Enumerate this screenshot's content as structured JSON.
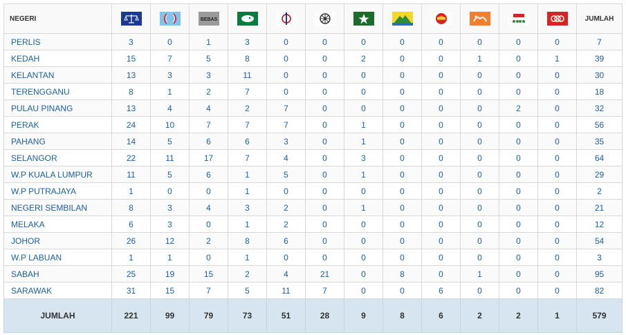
{
  "header": {
    "negeri_label": "NEGERI",
    "jumlah_label": "JUMLAH",
    "bebas_label": "BEBAS",
    "parties": [
      {
        "icon": "bn-scales-icon",
        "color": "#1a3a8f"
      },
      {
        "icon": "pkr-eye-icon",
        "color": "#7fc4ec"
      },
      {
        "icon": "bebas-independent-icon",
        "color": "#9a9a9a"
      },
      {
        "icon": "pas-moon-icon",
        "color": "#0b7a3e"
      },
      {
        "icon": "dap-rocket-icon",
        "color": "#cc0000"
      },
      {
        "icon": "wheel-icon",
        "color": "#333333"
      },
      {
        "icon": "star-icon",
        "color": "#1d6b2a"
      },
      {
        "icon": "mountain-icon",
        "color": "#2a6fb6"
      },
      {
        "icon": "sunrise-icon",
        "color": "#e8a317"
      },
      {
        "icon": "hands-icon",
        "color": "#f08030"
      },
      {
        "icon": "stars-emblem-icon",
        "color": "#d42424"
      },
      {
        "icon": "rings-icon",
        "color": "#d42424"
      }
    ]
  },
  "rows": [
    {
      "state": "PERLIS",
      "values": [
        "3",
        "0",
        "1",
        "3",
        "0",
        "0",
        "0",
        "0",
        "0",
        "0",
        "0",
        "0"
      ],
      "total": "7"
    },
    {
      "state": "KEDAH",
      "values": [
        "15",
        "7",
        "5",
        "8",
        "0",
        "0",
        "2",
        "0",
        "0",
        "1",
        "0",
        "1"
      ],
      "total": "39"
    },
    {
      "state": "KELANTAN",
      "values": [
        "13",
        "3",
        "3",
        "11",
        "0",
        "0",
        "0",
        "0",
        "0",
        "0",
        "0",
        "0"
      ],
      "total": "30"
    },
    {
      "state": "TERENGGANU",
      "values": [
        "8",
        "1",
        "2",
        "7",
        "0",
        "0",
        "0",
        "0",
        "0",
        "0",
        "0",
        "0"
      ],
      "total": "18"
    },
    {
      "state": "PULAU PINANG",
      "values": [
        "13",
        "4",
        "4",
        "2",
        "7",
        "0",
        "0",
        "0",
        "0",
        "0",
        "2",
        "0"
      ],
      "total": "32"
    },
    {
      "state": "PERAK",
      "values": [
        "24",
        "10",
        "7",
        "7",
        "7",
        "0",
        "1",
        "0",
        "0",
        "0",
        "0",
        "0"
      ],
      "total": "56"
    },
    {
      "state": "PAHANG",
      "values": [
        "14",
        "5",
        "6",
        "6",
        "3",
        "0",
        "1",
        "0",
        "0",
        "0",
        "0",
        "0"
      ],
      "total": "35"
    },
    {
      "state": "SELANGOR",
      "values": [
        "22",
        "11",
        "17",
        "7",
        "4",
        "0",
        "3",
        "0",
        "0",
        "0",
        "0",
        "0"
      ],
      "total": "64"
    },
    {
      "state": "W.P KUALA LUMPUR",
      "values": [
        "11",
        "5",
        "6",
        "1",
        "5",
        "0",
        "1",
        "0",
        "0",
        "0",
        "0",
        "0"
      ],
      "total": "29"
    },
    {
      "state": "W.P PUTRAJAYA",
      "values": [
        "1",
        "0",
        "0",
        "1",
        "0",
        "0",
        "0",
        "0",
        "0",
        "0",
        "0",
        "0"
      ],
      "total": "2"
    },
    {
      "state": "NEGERI SEMBILAN",
      "values": [
        "8",
        "3",
        "4",
        "3",
        "2",
        "0",
        "1",
        "0",
        "0",
        "0",
        "0",
        "0"
      ],
      "total": "21"
    },
    {
      "state": "MELAKA",
      "values": [
        "6",
        "3",
        "0",
        "1",
        "2",
        "0",
        "0",
        "0",
        "0",
        "0",
        "0",
        "0"
      ],
      "total": "12"
    },
    {
      "state": "JOHOR",
      "values": [
        "26",
        "12",
        "2",
        "8",
        "6",
        "0",
        "0",
        "0",
        "0",
        "0",
        "0",
        "0"
      ],
      "total": "54"
    },
    {
      "state": "W.P LABUAN",
      "values": [
        "1",
        "1",
        "0",
        "1",
        "0",
        "0",
        "0",
        "0",
        "0",
        "0",
        "0",
        "0"
      ],
      "total": "3"
    },
    {
      "state": "SABAH",
      "values": [
        "25",
        "19",
        "15",
        "2",
        "4",
        "21",
        "0",
        "8",
        "0",
        "1",
        "0",
        "0"
      ],
      "total": "95"
    },
    {
      "state": "SARAWAK",
      "values": [
        "31",
        "15",
        "7",
        "5",
        "11",
        "7",
        "0",
        "0",
        "6",
        "0",
        "0",
        "0"
      ],
      "total": "82"
    }
  ],
  "footer": {
    "label": "JUMLAH",
    "values": [
      "221",
      "99",
      "79",
      "73",
      "51",
      "28",
      "9",
      "8",
      "6",
      "2",
      "2",
      "1"
    ],
    "total": "579"
  }
}
